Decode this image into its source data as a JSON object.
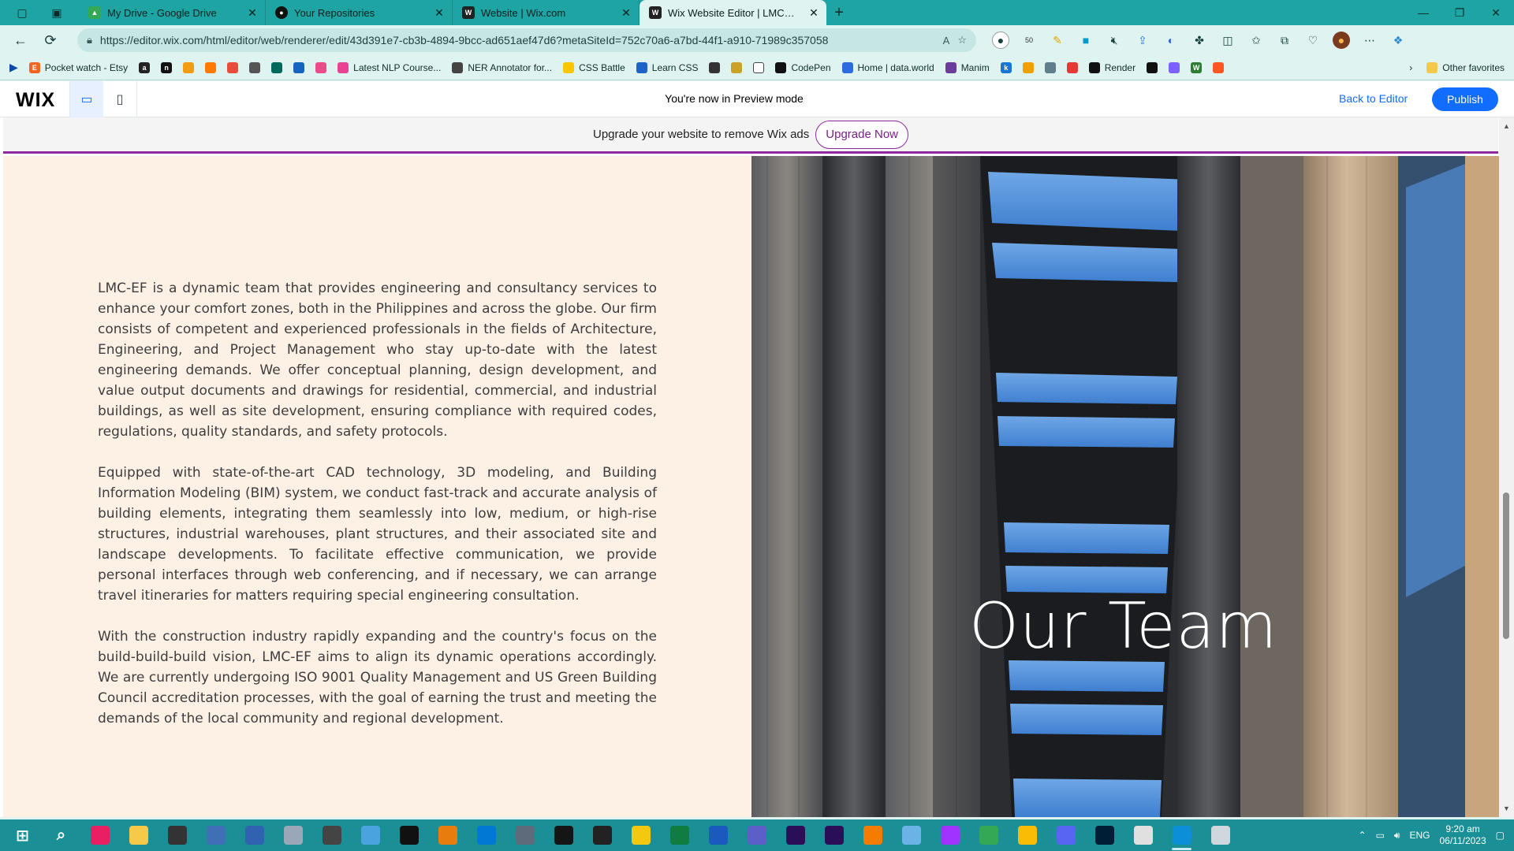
{
  "browser": {
    "tabs": [
      {
        "label": "My Drive - Google Drive",
        "icon": "google-drive-icon",
        "active": false
      },
      {
        "label": "Your Repositories",
        "icon": "github-icon",
        "active": false
      },
      {
        "label": "Website | Wix.com",
        "icon": "wix-icon",
        "active": false
      },
      {
        "label": "Wix Website Editor | LMCEngine",
        "icon": "wix-icon",
        "active": true
      }
    ],
    "url": "https://editor.wix.com/html/editor/web/renderer/edit/43d391e7-cb3b-4894-9bcc-ad651aef47d6?metaSiteId=752c70a6-a7bd-44f1-a910-71989c357058",
    "extension_badge": "50"
  },
  "bookmarks": [
    {
      "label": "Pocket watch - Etsy",
      "icon": "etsy-icon",
      "color": "#f16521",
      "glyph": "E"
    },
    {
      "label": "",
      "icon": "amazon-icon",
      "color": "#222222",
      "glyph": "a"
    },
    {
      "label": "",
      "icon": "codesandbox-icon",
      "color": "#111111",
      "glyph": "n"
    },
    {
      "label": "",
      "icon": "box-icon",
      "color": "#f39c12",
      "glyph": ""
    },
    {
      "label": "",
      "icon": "fire-icon",
      "color": "#ff7a00",
      "glyph": ""
    },
    {
      "label": "",
      "icon": "circle-icon",
      "color": "#e74c3c",
      "glyph": ""
    },
    {
      "label": "",
      "icon": "document-icon",
      "color": "#555555",
      "glyph": ""
    },
    {
      "label": "",
      "icon": "sprout-icon",
      "color": "#00695c",
      "glyph": ""
    },
    {
      "label": "",
      "icon": "app-icon",
      "color": "#1565c0",
      "glyph": ""
    },
    {
      "label": "",
      "icon": "dribbble-icon",
      "color": "#ea4c89",
      "glyph": ""
    },
    {
      "label": "Latest NLP Course...",
      "icon": "nlp-icon",
      "color": "#e84393",
      "glyph": ""
    },
    {
      "label": "NER Annotator for...",
      "icon": "ner-icon",
      "color": "#444444",
      "glyph": ""
    },
    {
      "label": "CSS Battle",
      "icon": "cssbattle-icon",
      "color": "#f9c600",
      "glyph": ""
    },
    {
      "label": "Learn CSS",
      "icon": "learncss-icon",
      "color": "#1e64c8",
      "glyph": ""
    },
    {
      "label": "",
      "icon": "code-icon",
      "color": "#333333",
      "glyph": ""
    },
    {
      "label": "",
      "icon": "hand-icon",
      "color": "#c9a227",
      "glyph": ""
    },
    {
      "label": "",
      "icon": "square-icon",
      "color": "#ffffff",
      "glyph": ""
    },
    {
      "label": "CodePen",
      "icon": "codepen-icon",
      "color": "#111111",
      "glyph": ""
    },
    {
      "label": "Home | data.world",
      "icon": "dataworld-icon",
      "color": "#2d6cdf",
      "glyph": ""
    },
    {
      "label": "Manim",
      "icon": "manim-icon",
      "color": "#6a3d9a",
      "glyph": ""
    },
    {
      "label": "",
      "icon": "k-icon",
      "color": "#1976d2",
      "glyph": "k"
    },
    {
      "label": "",
      "icon": "link-icon",
      "color": "#f0a000",
      "glyph": ""
    },
    {
      "label": "",
      "icon": "grid-icon",
      "color": "#607d8b",
      "glyph": ""
    },
    {
      "label": "",
      "icon": "triangle-icon",
      "color": "#e53935",
      "glyph": ""
    },
    {
      "label": "Render",
      "icon": "render-icon",
      "color": "#111111",
      "glyph": ""
    },
    {
      "label": "",
      "icon": "a-icon",
      "color": "#111111",
      "glyph": ""
    },
    {
      "label": "",
      "icon": "figma-like-icon",
      "color": "#7b61ff",
      "glyph": ""
    },
    {
      "label": "",
      "icon": "w-icon",
      "color": "#2e7d32",
      "glyph": "W"
    },
    {
      "label": "",
      "icon": "orange-circle-icon",
      "color": "#ff5722",
      "glyph": ""
    }
  ],
  "bookmarks_right": {
    "other_favorites": "Other favorites"
  },
  "wix": {
    "logo": "WIX",
    "preview_message": "You're now in Preview mode",
    "back_to_editor": "Back to Editor",
    "publish": "Publish",
    "ad_text": "Upgrade your website to remove Wix ads",
    "upgrade_button": "Upgrade Now"
  },
  "page": {
    "paragraphs": [
      "LMC-EF is a dynamic team that provides engineering and consultancy services to enhance your comfort zones, both in the Philippines and across the globe. Our firm consists of competent and experienced professionals in the fields of Architecture, Engineering, and Project Management who stay up-to-date with the latest engineering demands. We offer conceptual planning, design development, and value output documents and drawings for residential, commercial, and industrial buildings, as well as site development, ensuring compliance with required codes, regulations, quality standards, and safety protocols.",
      "Equipped with state-of-the-art CAD technology, 3D modeling, and Building Information Modeling (BIM) system, we conduct fast-track and accurate analysis of building elements, integrating them seamlessly into low, medium, or high-rise structures, industrial warehouses, plant structures, and their associated site and landscape developments. To facilitate effective communication, we provide personal interfaces through web conferencing, and if necessary, we can arrange travel itineraries for matters requiring special engineering consultation.",
      "With the construction industry rapidly expanding and the country's focus on the build-build-build vision, LMC-EF aims to align its dynamic operations accordingly. We are currently undergoing ISO 9001 Quality Management and US Green Building Council accreditation processes, with the goal of earning the trust and meeting the demands of the local community and regional development."
    ],
    "hero_title": "Our Team"
  },
  "taskbar": {
    "time": "9:20 am",
    "date": "06/11/2023",
    "language": "ENG",
    "apps": [
      {
        "name": "start-icon",
        "color": "#ffffff"
      },
      {
        "name": "search-icon",
        "color": "#ffffff"
      },
      {
        "name": "music-app-icon",
        "color": "#e91e63"
      },
      {
        "name": "file-explorer-icon",
        "color": "#f7c948"
      },
      {
        "name": "calculator-icon",
        "color": "#333333"
      },
      {
        "name": "monitor-app-icon",
        "color": "#3f6fb5"
      },
      {
        "name": "remote-desktop-icon",
        "color": "#2f62b0"
      },
      {
        "name": "paint-icon",
        "color": "#9aa7b8"
      },
      {
        "name": "settings-icon",
        "color": "#444444"
      },
      {
        "name": "window-app-icon",
        "color": "#4aa3df"
      },
      {
        "name": "terminal-icon",
        "color": "#111111"
      },
      {
        "name": "blender-like-icon",
        "color": "#e87d0d"
      },
      {
        "name": "vscode-icon",
        "color": "#0078d4"
      },
      {
        "name": "git-app-icon",
        "color": "#5d6b7a"
      },
      {
        "name": "codesandbox-app-icon",
        "color": "#151515"
      },
      {
        "name": "paper-plane-icon",
        "color": "#222222"
      },
      {
        "name": "power-bi-icon",
        "color": "#f2c811"
      },
      {
        "name": "excel-icon",
        "color": "#107c41"
      },
      {
        "name": "word-icon",
        "color": "#185abd"
      },
      {
        "name": "teams-icon",
        "color": "#5b5fc7"
      },
      {
        "name": "after-effects-icon",
        "color": "#2a0f57"
      },
      {
        "name": "premiere-icon",
        "color": "#2a0f57"
      },
      {
        "name": "blender-icon",
        "color": "#f57c00"
      },
      {
        "name": "notepad-icon",
        "color": "#69b3e7"
      },
      {
        "name": "messenger-icon",
        "color": "#a033ff"
      },
      {
        "name": "chrome-icon",
        "color": "#34a853"
      },
      {
        "name": "chrome-alt-icon",
        "color": "#fbbc05"
      },
      {
        "name": "discord-icon",
        "color": "#5865f2"
      },
      {
        "name": "photoshop-icon",
        "color": "#001e36"
      },
      {
        "name": "snip-icon",
        "color": "#e0e0e0"
      },
      {
        "name": "edge-icon",
        "color": "#0c8fd6"
      },
      {
        "name": "tools-icon",
        "color": "#cfd8dc"
      }
    ],
    "active_app_index": 30
  }
}
